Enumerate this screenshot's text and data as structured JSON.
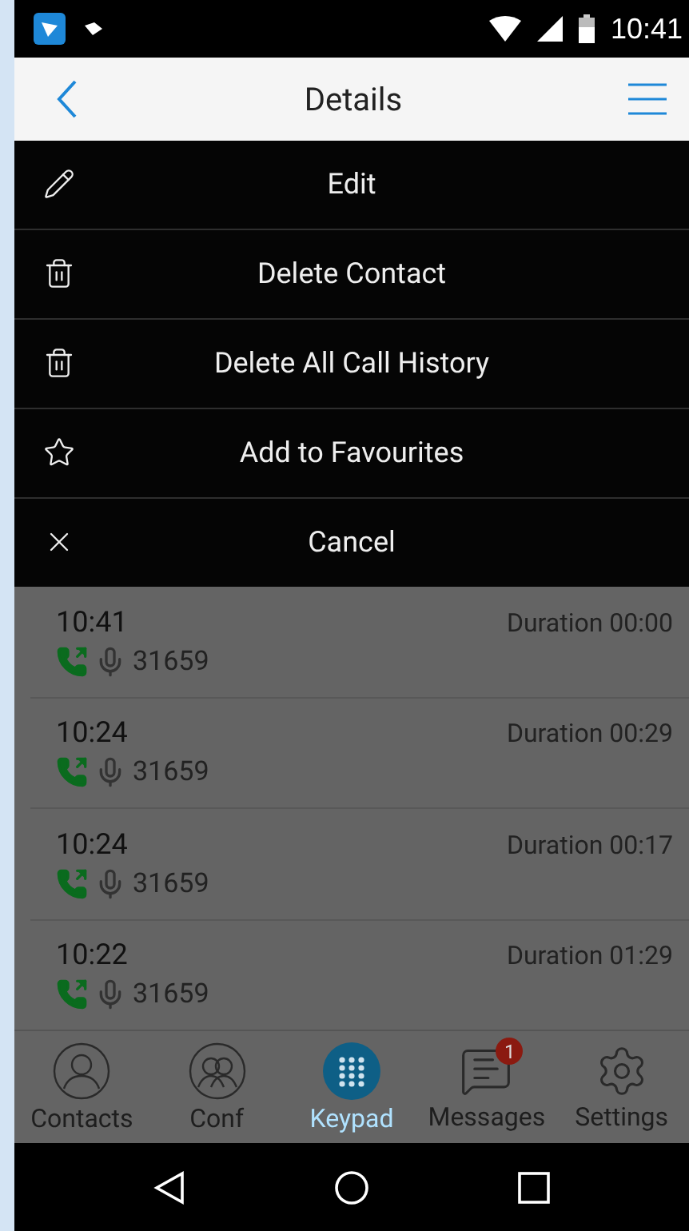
{
  "status_bar": {
    "time": "10:41"
  },
  "header": {
    "title": "Details"
  },
  "menu": [
    {
      "kind": "edit",
      "label": "Edit"
    },
    {
      "kind": "delete",
      "label": "Delete Contact"
    },
    {
      "kind": "delete",
      "label": "Delete All Call History"
    },
    {
      "kind": "favourite",
      "label": "Add to Favourites"
    },
    {
      "kind": "cancel",
      "label": "Cancel"
    }
  ],
  "calls": [
    {
      "time": "10:41",
      "number": "31659",
      "duration": "Duration 00:00"
    },
    {
      "time": "10:24",
      "number": "31659",
      "duration": "Duration 00:29"
    },
    {
      "time": "10:24",
      "number": "31659",
      "duration": "Duration 00:17"
    },
    {
      "time": "10:22",
      "number": "31659",
      "duration": "Duration 01:29"
    }
  ],
  "tabs": [
    {
      "kind": "contacts",
      "label": "Contacts",
      "selected": false
    },
    {
      "kind": "conf",
      "label": "Conf",
      "selected": false
    },
    {
      "kind": "keypad",
      "label": "Keypad",
      "selected": true
    },
    {
      "kind": "messages",
      "label": "Messages",
      "selected": false,
      "badge": "1"
    },
    {
      "kind": "settings",
      "label": "Settings",
      "selected": false
    }
  ]
}
